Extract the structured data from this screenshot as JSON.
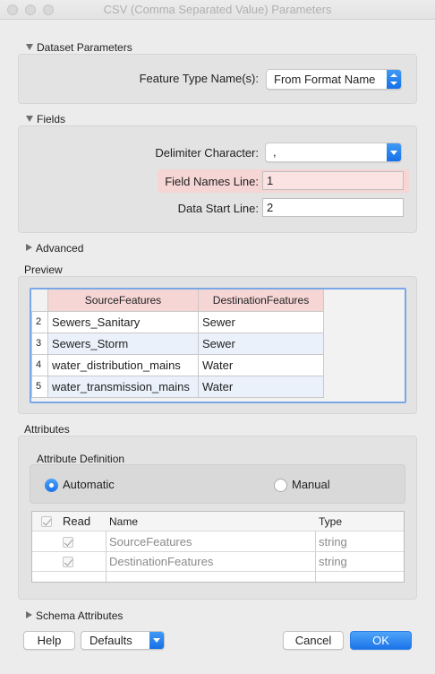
{
  "window": {
    "title": "CSV (Comma Separated Value) Parameters"
  },
  "dataset": {
    "header": "Dataset Parameters",
    "feature_type_label": "Feature Type Name(s):",
    "feature_type_value": "From Format Name"
  },
  "fields": {
    "header": "Fields",
    "delimiter_label": "Delimiter Character:",
    "delimiter_value": ",",
    "field_names_line_label": "Field Names Line:",
    "field_names_line_value": "1",
    "data_start_line_label": "Data Start Line:",
    "data_start_line_value": "2"
  },
  "advanced": {
    "header": "Advanced"
  },
  "preview": {
    "header": "Preview",
    "columns": [
      "SourceFeatures",
      "DestinationFeatures"
    ],
    "rows": [
      {
        "n": "2",
        "source": "Sewers_Sanitary",
        "dest": "Sewer"
      },
      {
        "n": "3",
        "source": "Sewers_Storm",
        "dest": "Sewer"
      },
      {
        "n": "4",
        "source": "water_distribution_mains",
        "dest": "Water"
      },
      {
        "n": "5",
        "source": "water_transmission_mains",
        "dest": "Water"
      }
    ]
  },
  "attributes": {
    "header": "Attributes",
    "definition_header": "Attribute Definition",
    "automatic_label": "Automatic",
    "manual_label": "Manual",
    "selected": "Automatic",
    "columns": {
      "read": "Read",
      "name": "Name",
      "type": "Type"
    },
    "rows": [
      {
        "name": "SourceFeatures",
        "type": "string"
      },
      {
        "name": "DestinationFeatures",
        "type": "string"
      }
    ]
  },
  "schema": {
    "header": "Schema Attributes"
  },
  "buttons": {
    "help": "Help",
    "defaults": "Defaults",
    "cancel": "Cancel",
    "ok": "OK"
  },
  "colors": {
    "accent": "#1b74ea",
    "highlight": "#f6d5d5",
    "row_alt": "#eaf1fb"
  }
}
